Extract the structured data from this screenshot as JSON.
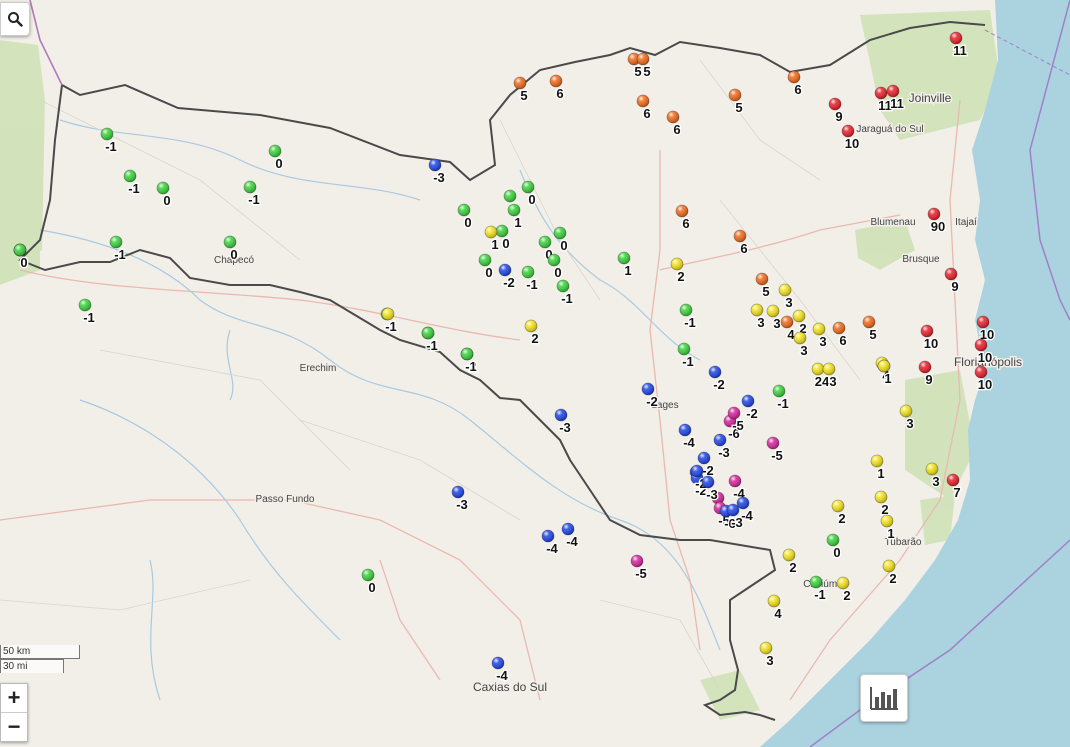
{
  "controls": {
    "zoom_in": "+",
    "zoom_out": "−",
    "scale_km": "50 km",
    "scale_mi": "30 mi",
    "search_icon": "magnifier",
    "chart_icon": "bar-chart"
  },
  "colors": {
    "red": "#e8202a",
    "orange": "#f06a1a",
    "yellow": "#f3e21c",
    "green": "#3ad23a",
    "blue": "#1f45e6",
    "magenta": "#d4249c",
    "state_border": "#4a4a4a",
    "sea": "#aad3df",
    "forest": "#c8dfb0"
  },
  "places": [
    {
      "name": "Joinville"
    },
    {
      "name": "Jaraguá do Sul"
    },
    {
      "name": "Blumenau"
    },
    {
      "name": "Itajaí"
    },
    {
      "name": "Brusque"
    },
    {
      "name": "Florianópolis"
    },
    {
      "name": "Chapecó"
    },
    {
      "name": "Erechim"
    },
    {
      "name": "Passo Fundo"
    },
    {
      "name": "Caxias do Sul"
    },
    {
      "name": "Tubarão"
    },
    {
      "name": "Criciúma"
    },
    {
      "name": "Lages"
    }
  ],
  "stations": [
    {
      "c": "orange",
      "v": "5"
    },
    {
      "c": "orange",
      "v": "6"
    },
    {
      "c": "orange",
      "v": "5"
    },
    {
      "c": "orange",
      "v": "5"
    },
    {
      "c": "orange",
      "v": "6"
    },
    {
      "c": "orange",
      "v": "6"
    },
    {
      "c": "orange",
      "v": "5"
    },
    {
      "c": "orange",
      "v": "6"
    },
    {
      "c": "red",
      "v": "11"
    },
    {
      "c": "red",
      "v": "11"
    },
    {
      "c": "red",
      "v": "11"
    },
    {
      "c": "red",
      "v": "9"
    },
    {
      "c": "red",
      "v": "10"
    },
    {
      "c": "green",
      "v": "-1"
    },
    {
      "c": "green",
      "v": "0"
    },
    {
      "c": "green",
      "v": "-1"
    },
    {
      "c": "green",
      "v": "0"
    },
    {
      "c": "green",
      "v": "-1"
    },
    {
      "c": "green",
      "v": "-1"
    },
    {
      "c": "green",
      "v": "0"
    },
    {
      "c": "green",
      "v": "0"
    },
    {
      "c": "green",
      "v": "-1"
    },
    {
      "c": "blue",
      "v": "-3"
    },
    {
      "c": "green",
      "v": "0"
    },
    {
      "c": "green",
      "v": "1"
    },
    {
      "c": "green",
      "v": "0"
    },
    {
      "c": "green",
      "v": "0"
    },
    {
      "c": "yellow",
      "v": "1"
    },
    {
      "c": "green",
      "v": "1"
    },
    {
      "c": "green",
      "v": "0"
    },
    {
      "c": "green",
      "v": "0"
    },
    {
      "c": "green",
      "v": "0"
    },
    {
      "c": "blue",
      "v": "-2"
    },
    {
      "c": "green",
      "v": "-1"
    },
    {
      "c": "green",
      "v": "0"
    },
    {
      "c": "green",
      "v": "-1"
    },
    {
      "c": "green",
      "v": "1"
    },
    {
      "c": "yellow",
      "v": "2"
    },
    {
      "c": "orange",
      "v": "6"
    },
    {
      "c": "orange",
      "v": "6"
    },
    {
      "c": "red",
      "v": "90"
    },
    {
      "c": "red",
      "v": "9"
    },
    {
      "c": "green",
      "v": "-1"
    },
    {
      "c": "yellow",
      "v": ""
    },
    {
      "c": "green",
      "v": "-1"
    },
    {
      "c": "yellow",
      "v": "2"
    },
    {
      "c": "orange",
      "v": "5"
    },
    {
      "c": "yellow",
      "v": "3"
    },
    {
      "c": "yellow",
      "v": "3"
    },
    {
      "c": "yellow",
      "v": "3"
    },
    {
      "c": "orange",
      "v": "4"
    },
    {
      "c": "yellow",
      "v": "2"
    },
    {
      "c": "yellow",
      "v": "3"
    },
    {
      "c": "yellow",
      "v": "3"
    },
    {
      "c": "orange",
      "v": "6"
    },
    {
      "c": "orange",
      "v": "5"
    },
    {
      "c": "red",
      "v": "10"
    },
    {
      "c": "red",
      "v": "10"
    },
    {
      "c": "red",
      "v": "10"
    },
    {
      "c": "red",
      "v": "10"
    },
    {
      "c": "red",
      "v": "9"
    },
    {
      "c": "green",
      "v": "-1"
    },
    {
      "c": "green",
      "v": "-1"
    },
    {
      "c": "yellow",
      "v": "24"
    },
    {
      "c": "yellow",
      "v": "4"
    },
    {
      "c": "yellow",
      "v": "3"
    },
    {
      "c": "blue",
      "v": "-2"
    },
    {
      "c": "blue",
      "v": "-2"
    },
    {
      "c": "blue",
      "v": "-2"
    },
    {
      "c": "green",
      "v": "-1"
    },
    {
      "c": "blue",
      "v": "-3"
    },
    {
      "c": "blue",
      "v": "-2"
    },
    {
      "c": "magenta",
      "v": "-6"
    },
    {
      "c": "magenta",
      "v": "-5"
    },
    {
      "c": "magenta",
      "v": "-5"
    },
    {
      "c": "blue",
      "v": "-4"
    },
    {
      "c": "blue",
      "v": "-3"
    },
    {
      "c": "blue",
      "v": "-2"
    },
    {
      "c": "blue",
      "v": "-3"
    },
    {
      "c": "magenta",
      "v": "-4"
    },
    {
      "c": "blue",
      "v": "-2"
    },
    {
      "c": "magenta",
      "v": "-6"
    },
    {
      "c": "magenta",
      "v": "-5"
    },
    {
      "c": "blue",
      "v": "-6"
    },
    {
      "c": "blue",
      "v": "-4"
    },
    {
      "c": "blue",
      "v": "-3"
    },
    {
      "c": "yellow",
      "v": "3"
    },
    {
      "c": "yellow",
      "v": "1"
    },
    {
      "c": "yellow",
      "v": "3"
    },
    {
      "c": "red",
      "v": "7"
    },
    {
      "c": "yellow",
      "v": "2"
    },
    {
      "c": "yellow",
      "v": "2"
    },
    {
      "c": "yellow",
      "v": "1"
    },
    {
      "c": "green",
      "v": "0"
    },
    {
      "c": "yellow",
      "v": "2"
    },
    {
      "c": "green",
      "v": "-1"
    },
    {
      "c": "yellow",
      "v": "2"
    },
    {
      "c": "yellow",
      "v": "2"
    },
    {
      "c": "yellow",
      "v": "4"
    },
    {
      "c": "yellow",
      "v": "3"
    },
    {
      "c": "magenta",
      "v": "-5"
    },
    {
      "c": "blue",
      "v": "-3"
    },
    {
      "c": "blue",
      "v": "-4"
    },
    {
      "c": "blue",
      "v": "-4"
    },
    {
      "c": "green",
      "v": "0"
    },
    {
      "c": "blue",
      "v": "-4"
    },
    {
      "c": "blue",
      "v": "-2"
    },
    {
      "c": "blue",
      "v": "-3"
    },
    {
      "c": "green",
      "v": "-1"
    },
    {
      "c": "yellow",
      "v": "1"
    },
    {
      "c": "green",
      "v": "-1"
    },
    {
      "c": "yellow",
      "v": ""
    },
    {
      "c": "green",
      "v": "0"
    },
    {
      "c": "green",
      "v": "0"
    }
  ]
}
